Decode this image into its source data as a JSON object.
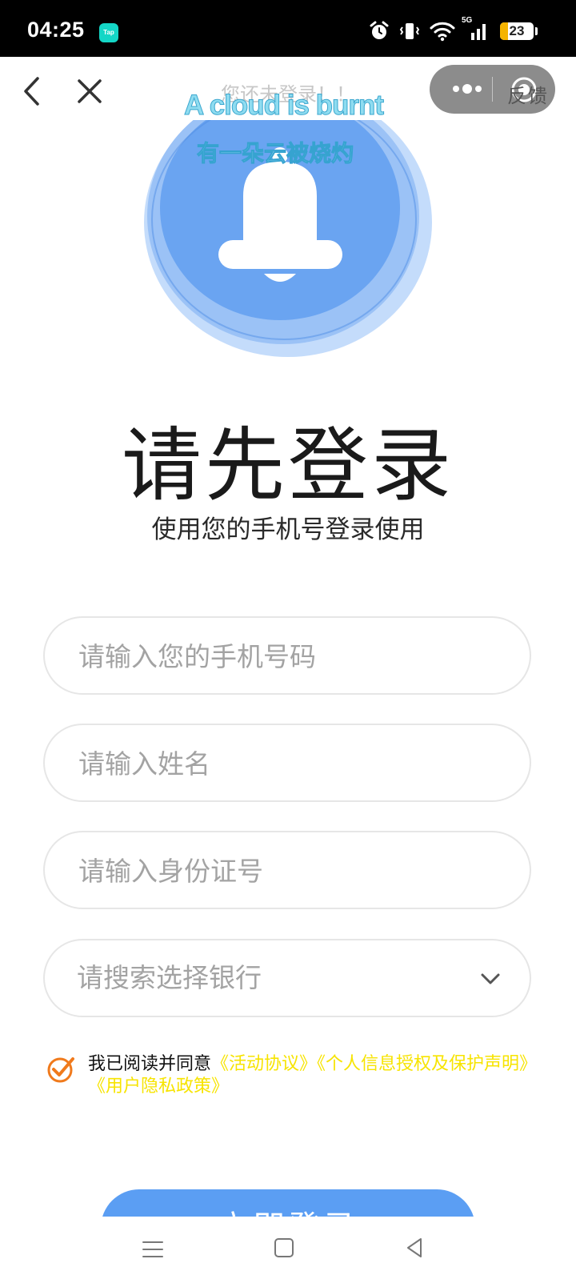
{
  "status_bar": {
    "time": "04:25",
    "app_badge": "Tap",
    "network_label": "5G",
    "battery": "23",
    "battery_level": 0.23
  },
  "header": {
    "title": "您还未登录！！",
    "feedback": "反馈"
  },
  "watermark": {
    "english": "A cloud is burnt",
    "chinese": "有一朵云被烧灼"
  },
  "main": {
    "heading": "请先登录",
    "subheading": "使用您的手机号登录使用"
  },
  "form": {
    "phone_placeholder": "请输入您的手机号码",
    "name_placeholder": "请输入姓名",
    "id_placeholder": "请输入身份证号",
    "bank_placeholder": "请搜索选择银行"
  },
  "agreement": {
    "prefix": "我已阅读并同意",
    "links": "《活动协议》《个人信息授权及保护声明》《用户隐私政策》"
  },
  "login_button": "立即登录",
  "colors": {
    "accent": "#5b9ef3",
    "link": "#f7e400",
    "check": "#f07a1c"
  }
}
